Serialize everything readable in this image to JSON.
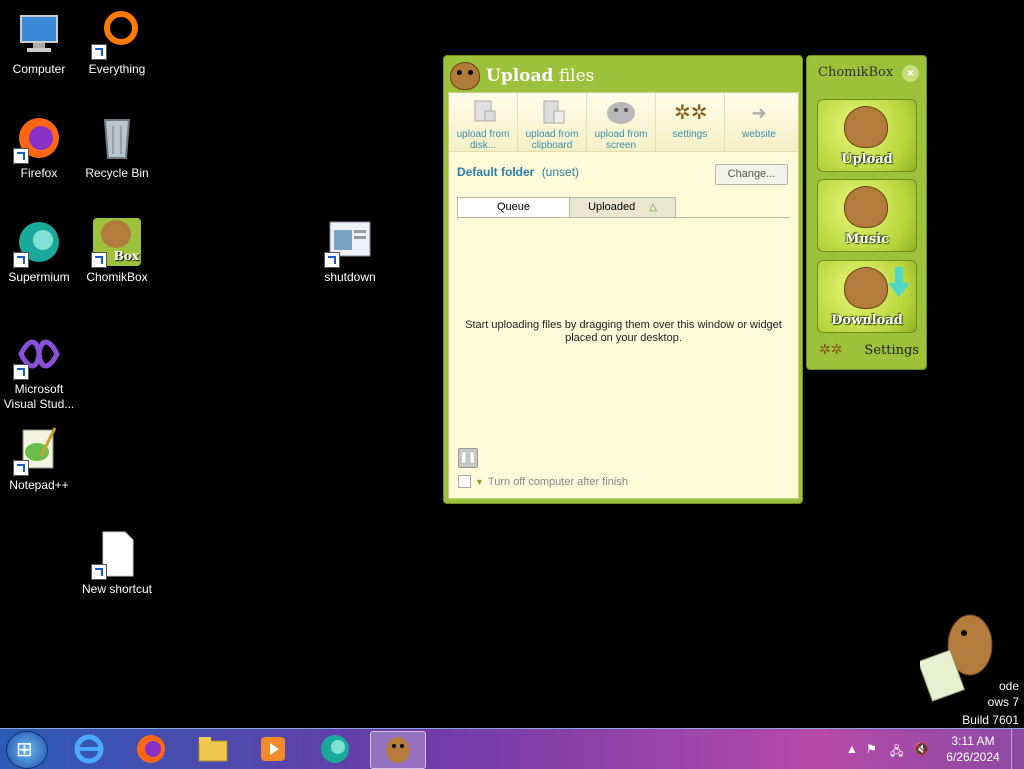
{
  "desktop": {
    "icons": [
      {
        "label": "Computer"
      },
      {
        "label": "Everything"
      },
      {
        "label": "Firefox"
      },
      {
        "label": "Recycle Bin"
      },
      {
        "label": "Supermium"
      },
      {
        "label": "ChomikBox"
      },
      {
        "label": "shutdown"
      },
      {
        "label": "Microsoft Visual Stud..."
      },
      {
        "label": "Notepad++"
      },
      {
        "label": "New shortcut"
      }
    ],
    "chomikbox_icon_text": "Box"
  },
  "upload_window": {
    "title_bold": "Upload",
    "title_rest": "files",
    "toolbar": [
      {
        "label": "upload from disk...",
        "icon": "disk-upload-icon"
      },
      {
        "label": "upload from clipboard",
        "icon": "clipboard-upload-icon"
      },
      {
        "label": "upload from screen",
        "icon": "screen-upload-icon"
      },
      {
        "label": "settings",
        "icon": "gears-icon"
      },
      {
        "label": "website",
        "icon": "website-icon"
      }
    ],
    "default_folder_label": "Default folder",
    "default_folder_value": "(unset)",
    "change_button": "Change...",
    "tabs": {
      "queue": "Queue",
      "uploaded": "Uploaded"
    },
    "empty_message": "Start uploading files by dragging them over this window or widget placed on your desktop.",
    "shutdown_option": "Turn off computer after finish"
  },
  "widget": {
    "title": "ChomikBox",
    "buttons": [
      {
        "label": "Upload"
      },
      {
        "label": "Music"
      },
      {
        "label": "Download"
      }
    ],
    "settings_label": "Settings"
  },
  "watermark": {
    "line1": "ode",
    "line2": "ows 7",
    "line3": "Build 7601"
  },
  "taskbar": {
    "time": "3:11 AM",
    "date": "6/26/2024"
  },
  "colors": {
    "chomik_green": "#9cc13a",
    "panel_bg": "#fefcd8",
    "link_blue": "#2b7ea5"
  }
}
